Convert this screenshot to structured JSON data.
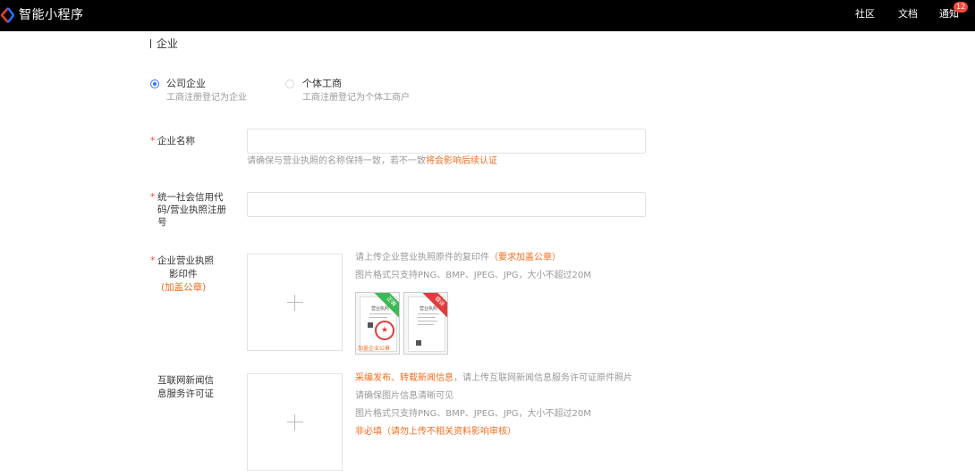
{
  "header": {
    "brand": "智能小程序",
    "nav": [
      {
        "label": "社区"
      },
      {
        "label": "文档"
      },
      {
        "label": "通知"
      }
    ],
    "notification_count": "12",
    "colors": {
      "background": "#000000",
      "logo_red": "#e03b3b",
      "logo_blue": "#2f6bff"
    }
  },
  "section": {
    "title": "企业"
  },
  "entity_type": {
    "options": [
      {
        "label": "公司企业",
        "desc": "工商注册登记为企业",
        "selected": true
      },
      {
        "label": "个体工商",
        "desc": "工商注册登记为个体工商户",
        "selected": false
      }
    ]
  },
  "fields": {
    "company_name": {
      "required_mark": "*",
      "label": "企业名称",
      "value": "",
      "hint_prefix": "请确保与营业执照的名称保持一致，若不一致",
      "hint_warning": "将会影响后续认证"
    },
    "credit_code": {
      "required_mark": "*",
      "label_line1": "统一社会信用代",
      "label_line2": "码/营业执照注册",
      "label_line3": "号",
      "value": ""
    },
    "license_copy": {
      "required_mark": "*",
      "label_line1": "企业营业执照",
      "label_line2": "影印件",
      "label_line3": "(加盖公章)",
      "hint1_prefix": "请上传企业营业执照原件的复印件",
      "hint1_warning": "（要求加盖公章）",
      "hint2": "图片格式只支持PNG、BMP、JPEG、JPG，大小不超过20M",
      "samples": [
        {
          "doc_title": "营业执照",
          "corner": "正确",
          "caption": "加盖企业公章",
          "corner_color": "#3cba54"
        },
        {
          "doc_title": "营业执照",
          "corner": "错误",
          "caption": "",
          "corner_color": "#e23b3b"
        }
      ]
    },
    "news_license": {
      "label_line1": "互联网新闻信",
      "label_line2": "息服务许可证",
      "hint1_warning": "采编发布、转载新闻信息",
      "hint1_rest": "，请上传互联网新闻信息服务许可证原件照片",
      "hint2": "请确保图片信息清晰可见",
      "hint3": "图片格式只支持PNG、BMP、JPEG、JPG，大小不超过20M",
      "hint4": "非必填（请勿上传不相关资料影响审核）"
    }
  },
  "colors": {
    "accent": "#3370ff",
    "warning": "#f26d1f",
    "required": "#f5483b",
    "muted": "#999999"
  }
}
